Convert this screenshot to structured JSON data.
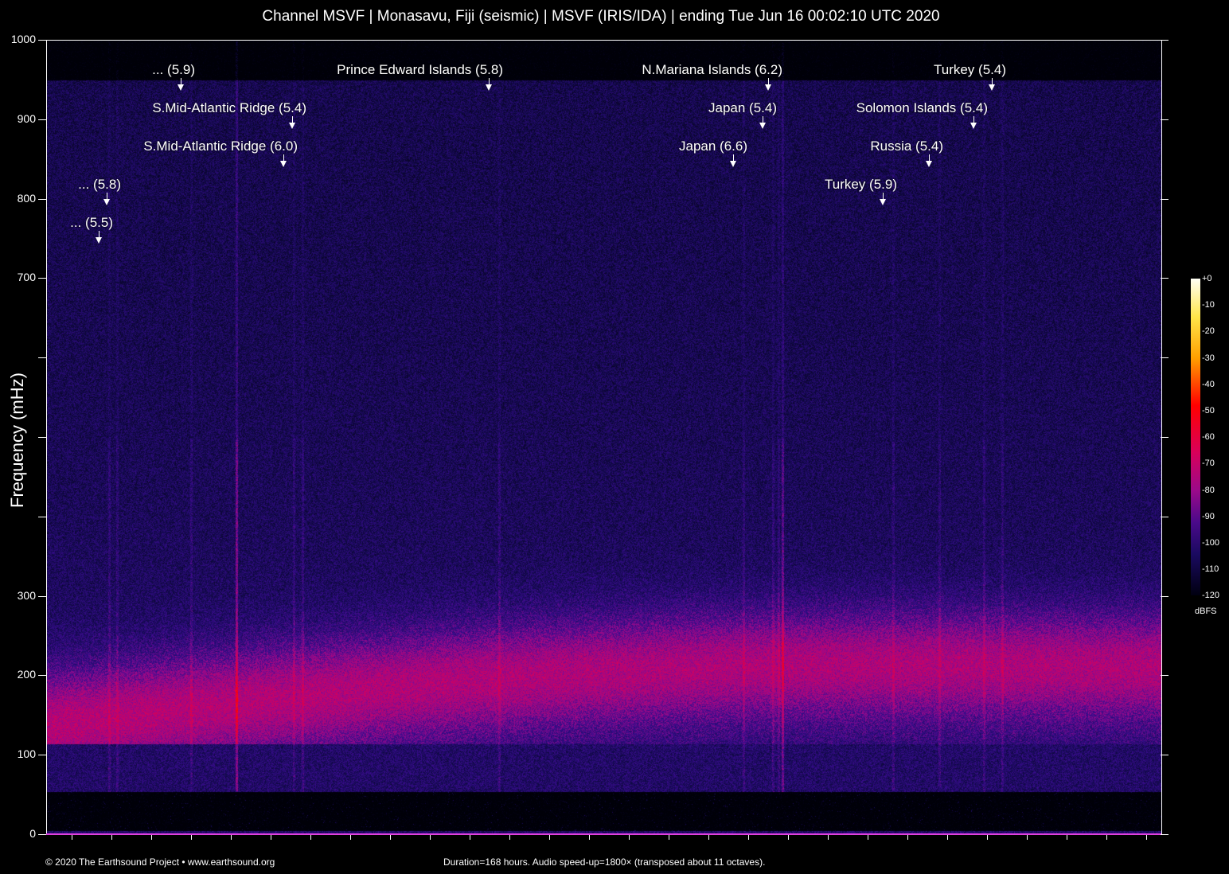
{
  "chart_data": {
    "type": "heatmap",
    "title": "Channel MSVF | Monasavu, Fiji (seismic) | MSVF (IRIS/IDA) | ending Tue Jun 16 00:02:10 UTC 2020",
    "ylabel": "Frequency (mHz)",
    "ylim": [
      0,
      1000
    ],
    "yticks": [
      0,
      100,
      200,
      300,
      400,
      500,
      600,
      700,
      800,
      900,
      1000
    ],
    "ytick_labels": [
      "0",
      "100",
      "200",
      "300",
      "",
      "",
      "",
      "700",
      "800",
      "900",
      "1000"
    ],
    "duration_hours": 168,
    "colorbar": {
      "unit": "dBFS",
      "range": [
        -120,
        0
      ],
      "labels": [
        "+0",
        "-10",
        "-20",
        "-30",
        "-40",
        "-50",
        "-60",
        "-70",
        "-80",
        "-90",
        "-100",
        "-110",
        "-120"
      ]
    },
    "events": [
      {
        "label": "... (5.5)",
        "hour": 7.9
      },
      {
        "label": "... (5.8)",
        "hour": 9.1
      },
      {
        "label": "... (5.9)",
        "hour": 20.3
      },
      {
        "label": "S.Mid-Atlantic Ridge (5.4)",
        "hour": 37.1
      },
      {
        "label": "S.Mid-Atlantic Ridge (6.0)",
        "hour": 35.8
      },
      {
        "label": "Prince Edward Islands (5.8)",
        "hour": 66.7
      },
      {
        "label": "N.Mariana Islands (6.2)",
        "hour": 108.8
      },
      {
        "label": "Japan (5.4)",
        "hour": 108.0
      },
      {
        "label": "Japan (6.6)",
        "hour": 103.6
      },
      {
        "label": "Turkey (5.9)",
        "hour": 126.1
      },
      {
        "label": "Russia (5.4)",
        "hour": 133.1
      },
      {
        "label": "Solomon Islands (5.4)",
        "hour": 139.8
      },
      {
        "label": "Turkey (5.4)",
        "hour": 142.6
      }
    ]
  },
  "footer": {
    "copyright": "© 2020 The Earthsound Project • www.earthsound.org",
    "info": "Duration=168 hours. Audio speed-up=1800× (transposed about 11 octaves)."
  }
}
